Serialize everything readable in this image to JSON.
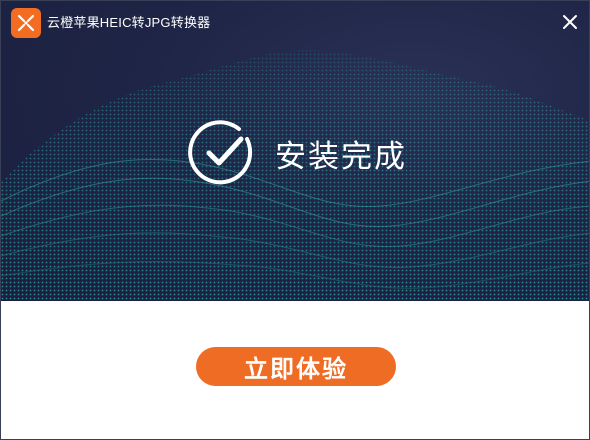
{
  "window": {
    "title": "云橙苹果HEIC转JPG转换器"
  },
  "icons": {
    "app_logo": "app-logo-icon",
    "close": "close-icon",
    "success": "check-circle-icon"
  },
  "status": {
    "message": "安装完成"
  },
  "actions": {
    "start_label": "立即体验"
  },
  "colors": {
    "accent": "#ee6c23",
    "banner_bg": "#1f2546",
    "wave": "#2fb3b0",
    "text_light": "#ffffff"
  }
}
